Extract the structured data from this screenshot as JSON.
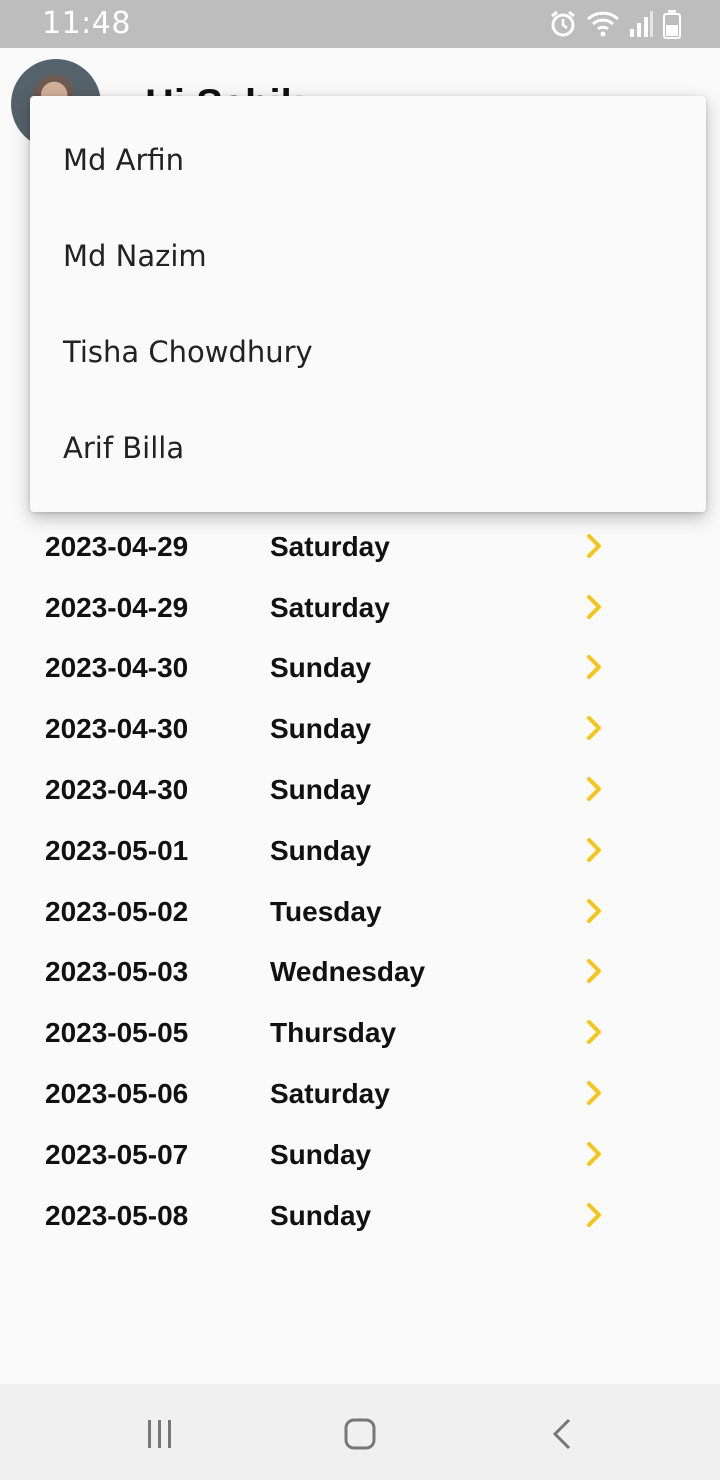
{
  "status_bar": {
    "time": "11:48",
    "icons": [
      "alarm-icon",
      "wifi-icon",
      "signal-icon",
      "battery-icon"
    ]
  },
  "header": {
    "greeting": "Hi Sabik"
  },
  "menu": {
    "items": [
      {
        "label": "Md Arfin"
      },
      {
        "label": "Md Nazim"
      },
      {
        "label": "Tisha Chowdhury"
      },
      {
        "label": "Arif Billa"
      }
    ]
  },
  "list": {
    "rows": [
      {
        "date": "2023-04-29",
        "day": "Saturday"
      },
      {
        "date": "2023-04-29",
        "day": "Saturday"
      },
      {
        "date": "2023-04-29",
        "day": "Saturday"
      },
      {
        "date": "2023-04-30",
        "day": "Sunday"
      },
      {
        "date": "2023-04-30",
        "day": "Sunday"
      },
      {
        "date": "2023-04-30",
        "day": "Sunday"
      },
      {
        "date": "2023-05-01",
        "day": "Sunday"
      },
      {
        "date": "2023-05-02",
        "day": "Tuesday"
      },
      {
        "date": "2023-05-03",
        "day": "Wednesday"
      },
      {
        "date": "2023-05-05",
        "day": "Thursday"
      },
      {
        "date": "2023-05-06",
        "day": "Saturday"
      },
      {
        "date": "2023-05-07",
        "day": "Sunday"
      },
      {
        "date": "2023-05-08",
        "day": "Sunday"
      }
    ],
    "chevron_color": "#f5c518"
  },
  "nav_bar": {
    "buttons": [
      "recent-apps-icon",
      "home-icon",
      "back-icon"
    ]
  }
}
